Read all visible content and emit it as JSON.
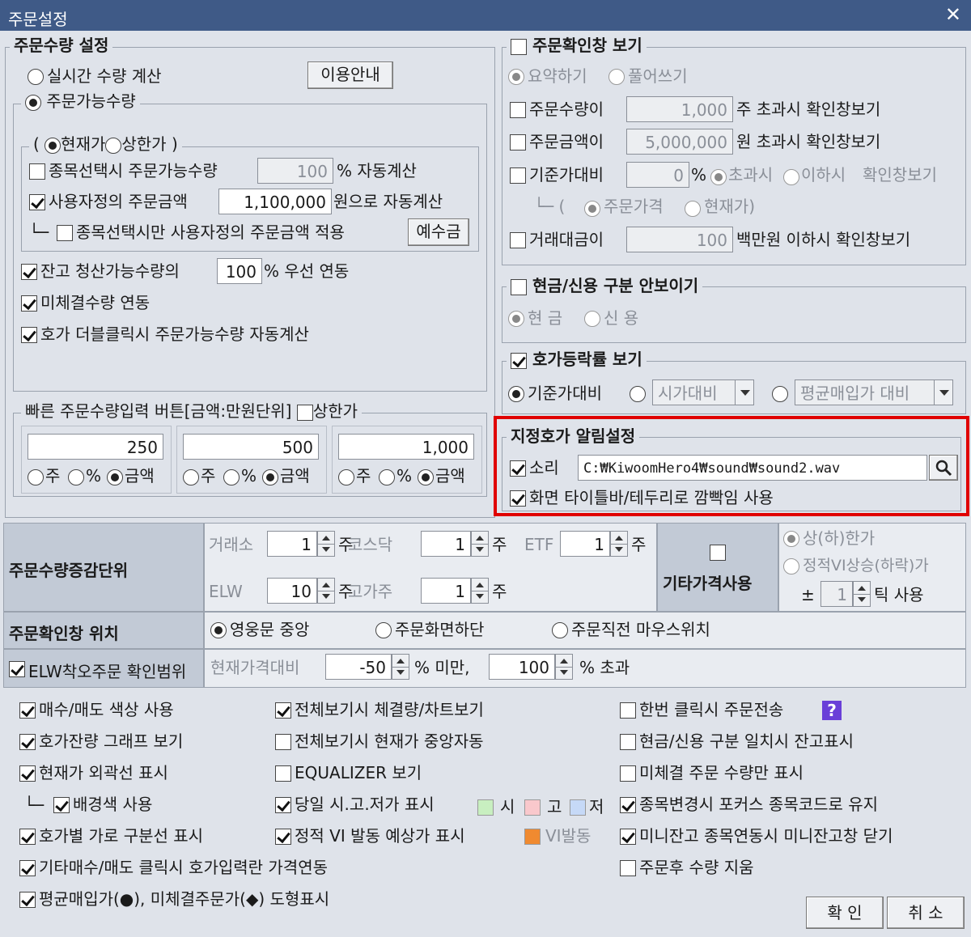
{
  "window": {
    "title": "주문설정",
    "close": "✕"
  },
  "qty": {
    "title": "주문수량 설정",
    "realtime": "실시간 수량 계산",
    "help_btn": "이용안내",
    "possible": "주문가능수량",
    "price_paren_open": "(",
    "price_current": "현재가",
    "price_upper": "상한가",
    "price_paren_close": ")",
    "auto_select": "종목선택시 주문가능수량",
    "auto_pct": "100",
    "auto_pct_suffix": "% 자동계산",
    "user_amt": "사용자정의 주문금액",
    "user_amt_value": "1,100,000",
    "user_amt_suffix": "원으로 자동계산",
    "tree": "└─",
    "only_select": "종목선택시만 사용자정의 주문금액 적용",
    "deposit_btn": "예수금",
    "balance": "잔고 청산가능수량의",
    "balance_pct": "100",
    "balance_suffix": "% 우선 연동",
    "unfilled": "미체결수량 연동",
    "dblclick": "호가 더블클릭시 주문가능수량 자동계산"
  },
  "quick": {
    "title": "빠른 주문수량입력 버튼[금액:만원단위]",
    "upper": "상한가",
    "values": [
      "250",
      "500",
      "1,000"
    ],
    "opt_share": "주",
    "opt_pct": "%",
    "opt_amt": "금액"
  },
  "confirm": {
    "title": "주문확인창 보기",
    "summary": "요약하기",
    "full": "풀어쓰기",
    "qty_lbl": "주문수량이",
    "qty_val": "1,000",
    "qty_suffix": "주 초과시 확인창보기",
    "amt_lbl": "주문금액이",
    "amt_val": "5,000,000",
    "amt_suffix": "원 초과시 확인창보기",
    "base_lbl": "기준가대비",
    "base_val": "0",
    "base_pct": "%",
    "over": "초과시",
    "under": "이하시",
    "base_suffix": "확인창보기",
    "base_tree": "└─ (",
    "base_order": "주문가격",
    "base_cur": "현재가)",
    "trade_lbl": "거래대금이",
    "trade_val": "100",
    "trade_suffix": "백만원 이하시 확인창보기"
  },
  "cash": {
    "title": "현금/신용 구분 안보이기",
    "cash": "현 금",
    "credit": "신 용"
  },
  "rate": {
    "title": "호가등락률 보기",
    "base": "기준가대비",
    "open": "시가대비",
    "avg": "평균매입가 대비"
  },
  "alert": {
    "title": "지정호가 알림설정",
    "sound": "소리",
    "path": "C:₩KiwoomHero4₩sound₩sound2.wav",
    "blink": "화면 타이틀바/테두리로 깜빡임 사용"
  },
  "unit": {
    "header": "주문수량증감단위",
    "exch": "거래소",
    "exch_v": "1",
    "kosdaq": "코스닥",
    "kosdaq_v": "1",
    "etf": "ETF",
    "etf_v": "1",
    "elw": "ELW",
    "elw_v": "10",
    "high": "고가주",
    "high_v": "1",
    "share": "주",
    "other_header": "기타가격사용",
    "upper_lower": "상(하)한가",
    "vi": "정적VI상승(하락)가",
    "pm": "±",
    "tick_v": "1",
    "tick_suffix": "틱 사용"
  },
  "pos": {
    "header": "주문확인창 위치",
    "center": "영웅문 중앙",
    "bottom": "주문화면하단",
    "mouse": "주문직전 마우스위치"
  },
  "elw": {
    "header": "ELW착오주문 확인범위",
    "base": "현재가격대비",
    "low": "-50",
    "low_suffix": "% 미만,",
    "high": "100",
    "high_suffix": "% 초과"
  },
  "opts": {
    "c1": [
      "매수/매도 색상 사용",
      "호가잔량 그래프 보기",
      "현재가 외곽선 표시",
      "배경색 사용",
      "호가별 가로 구분선 표시",
      "기타매수/매도 클릭시 호가입력란 가격연동",
      "평균매입가(●), 미체결주문가(◆) 도형표시"
    ],
    "c2": [
      "전체보기시 체결량/차트보기",
      "전체보기시 현재가 중앙자동",
      "EQUALIZER 보기",
      "당일 시.고.저가 표시",
      "정적 VI 발동 예상가 표시"
    ],
    "c3": [
      "한번 클릭시 주문전송",
      "현금/신용 구분 일치시 잔고표시",
      "미체결 주문 수량만 표시",
      "종목변경시 포커스 종목코드로 유지",
      "미니잔고 종목연동시 미니잔고창 닫기",
      "주문후 수량 지움"
    ],
    "tree": "└─",
    "si": "시",
    "go": "고",
    "jeo": "저",
    "vi": "VI발동",
    "help": "?"
  },
  "buttons": {
    "ok": "확 인",
    "cancel": "취 소"
  },
  "colors": {
    "si": "#c8efc0",
    "go": "#f9c8cc",
    "jeo": "#c6d9f7",
    "vi": "#f08a30",
    "alert_border": "#e00000",
    "help": "#6a3fd8"
  }
}
